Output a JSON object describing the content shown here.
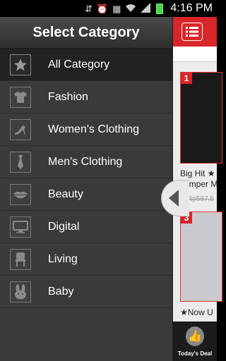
{
  "status_bar": {
    "time": "4:16 PM",
    "icons": [
      "usb-icon",
      "alarm-icon",
      "calendar-icon",
      "wifi-icon",
      "signal-icon",
      "battery-icon"
    ]
  },
  "drawer": {
    "title": "Select Category",
    "items": [
      {
        "label": "All Category",
        "icon": "star-icon",
        "glyph": "★"
      },
      {
        "label": "Fashion",
        "icon": "tshirt-icon",
        "glyph": "👕"
      },
      {
        "label": "Women's Clothing",
        "icon": "high-heel-icon",
        "glyph": "👠"
      },
      {
        "label": "Men's Clothing",
        "icon": "necktie-icon",
        "glyph": "👔"
      },
      {
        "label": "Beauty",
        "icon": "lips-icon",
        "glyph": "💋"
      },
      {
        "label": "Digital",
        "icon": "monitor-icon",
        "glyph": "▭"
      },
      {
        "label": "Living",
        "icon": "chair-icon",
        "glyph": "🪑"
      },
      {
        "label": "Baby",
        "icon": "bunny-icon",
        "glyph": "🐰"
      }
    ]
  },
  "main": {
    "products": [
      {
        "rank": "1",
        "title": "Big Hit ★",
        "subtitle": "Jumper M",
        "price": "Rp587,5"
      },
      {
        "rank": "3",
        "title": "★Now U"
      }
    ],
    "bottom_tab_label": "Today's Deal"
  },
  "colors": {
    "accent": "#d8262a",
    "drawer_bg": "#3a3a3a",
    "selected_bg": "#222222"
  }
}
